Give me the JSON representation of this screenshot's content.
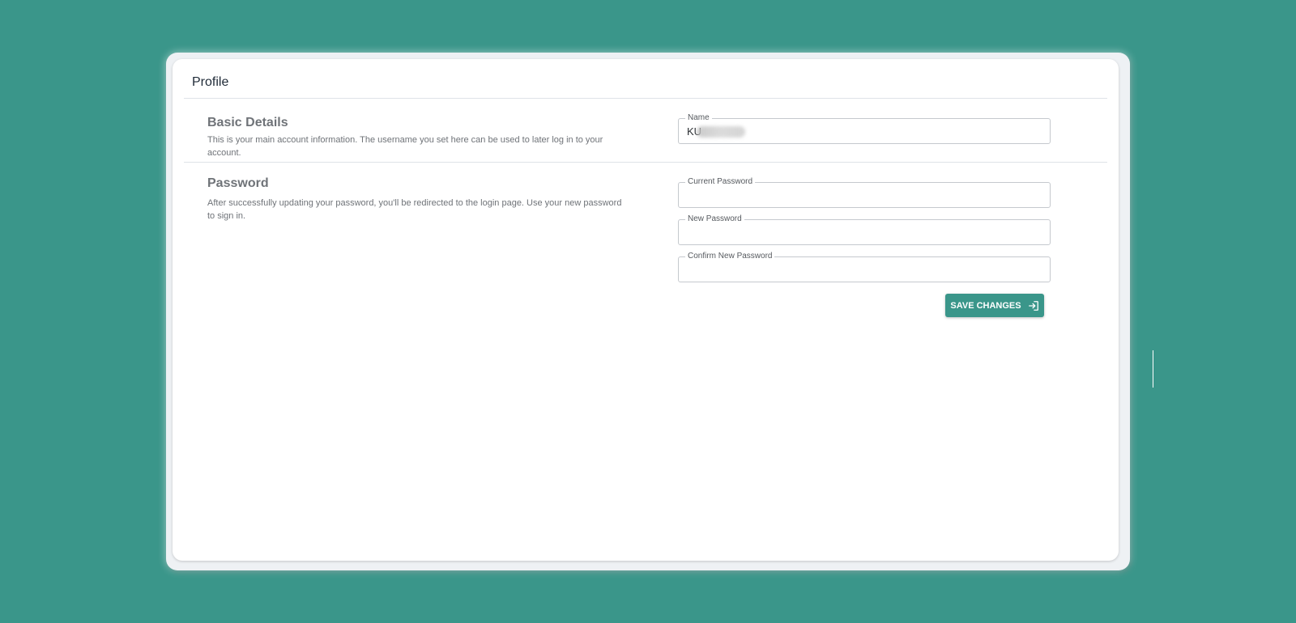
{
  "page": {
    "title": "Profile"
  },
  "basic_details": {
    "title": "Basic Details",
    "description": "This is your main account information. The username you set here can be used to later log in to your account.",
    "name_label": "Name",
    "name_value": "KU"
  },
  "password": {
    "title": "Password",
    "description": "After successfully updating your password, you'll be redirected to the login page. Use your new password to sign in.",
    "current_label": "Current Password",
    "current_value": "",
    "new_label": "New Password",
    "new_value": "",
    "confirm_label": "Confirm New Password",
    "confirm_value": ""
  },
  "actions": {
    "save_label": "SAVE CHANGES",
    "save_icon": "login-icon"
  },
  "colors": {
    "background": "#3a968a",
    "accent": "#3a968a",
    "card": "#ffffff"
  }
}
